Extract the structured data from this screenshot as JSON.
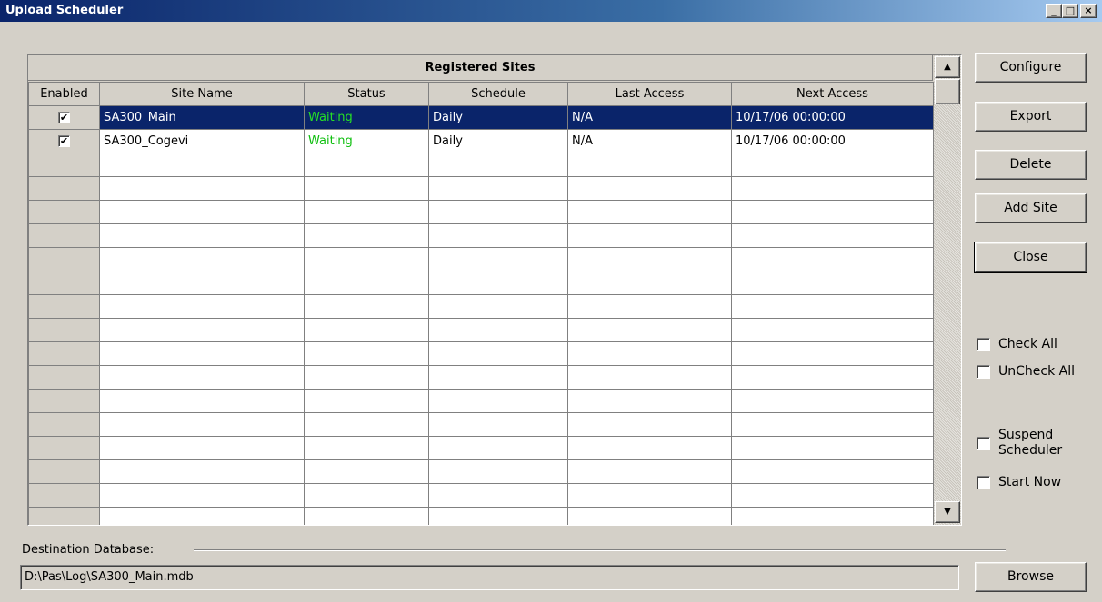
{
  "window": {
    "title": "Upload Scheduler",
    "controls": [
      "_",
      "□",
      "×"
    ]
  },
  "grid": {
    "title": "Registered Sites",
    "columns": [
      "Enabled",
      "Site Name",
      "Status",
      "Schedule",
      "Last Access",
      "Next Access"
    ],
    "rows": [
      {
        "enabled": true,
        "site_name": "SA300_Main",
        "status": "Waiting",
        "schedule": "Daily",
        "last_access": "N/A",
        "next_access": "10/17/06 00:00:00",
        "selected": true
      },
      {
        "enabled": true,
        "site_name": "SA300_Cogevi",
        "status": "Waiting",
        "schedule": "Daily",
        "last_access": "N/A",
        "next_access": "10/17/06 00:00:00",
        "selected": false
      }
    ],
    "empty_rows": 16,
    "status_color": "#0fbf0f",
    "selection_color": "#0a246a"
  },
  "scrollbar": {
    "up_arrow": "▲",
    "down_arrow": "▼"
  },
  "buttons": {
    "configure": "Configure",
    "export": "Export",
    "delete": "Delete",
    "add_site": "Add Site",
    "close": "Close",
    "browse": "Browse"
  },
  "checkboxes": {
    "check_all": "Check All",
    "uncheck_all": "UnCheck All",
    "suspend_line1": "Suspend",
    "suspend_line2": "Scheduler",
    "start_now": "Start Now"
  },
  "destination": {
    "label": "Destination Database:",
    "path": "D:\\Pas\\Log\\SA300_Main.mdb"
  }
}
